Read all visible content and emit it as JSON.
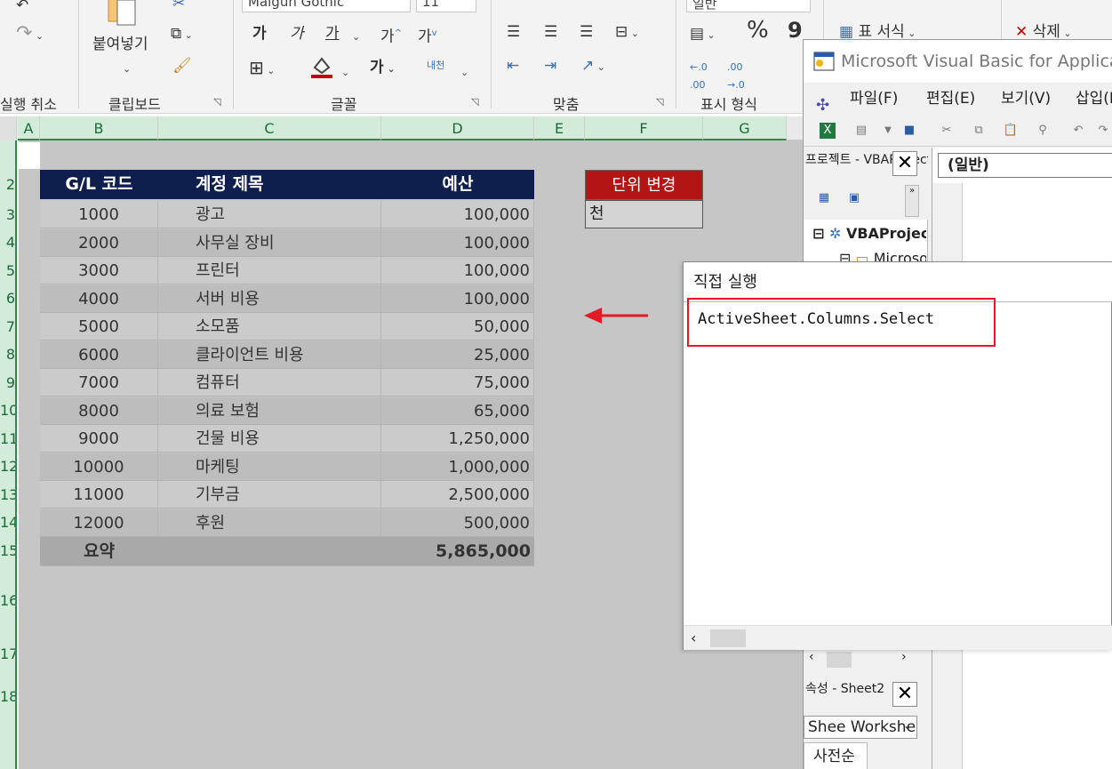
{
  "ribbon": {
    "undo_group_label": "실행 취소",
    "clipboard": {
      "paste_label": "붙여넣기",
      "group_label": "클립보드"
    },
    "font": {
      "font_name": "Malgun Gothic",
      "font_size": "11",
      "bold": "가",
      "italic": "가",
      "underline": "가",
      "grow": "가",
      "shrink": "가",
      "bold2": "가",
      "phonetic": "내천",
      "group_label": "글꼴"
    },
    "alignment": {
      "group_label": "맞춤"
    },
    "number": {
      "format_value": "일반",
      "percent": "%",
      "comma": "9",
      "group_label": "표시 형식"
    },
    "styles": {
      "format_table": "표 서식"
    },
    "cells": {
      "delete": "삭제"
    }
  },
  "columns": [
    "A",
    "B",
    "C",
    "D",
    "E",
    "F",
    "G"
  ],
  "rows": [
    "2",
    "3",
    "4",
    "5",
    "6",
    "7",
    "8",
    "9",
    "10",
    "11",
    "12",
    "13",
    "14",
    "15",
    "16",
    "17",
    "18"
  ],
  "table": {
    "headers": [
      "G/L 코드",
      "계정 제목",
      "예산"
    ],
    "rows": [
      [
        "1000",
        "광고",
        "100,000"
      ],
      [
        "2000",
        "사무실 장비",
        "100,000"
      ],
      [
        "3000",
        "프린터",
        "100,000"
      ],
      [
        "4000",
        "서버 비용",
        "100,000"
      ],
      [
        "5000",
        "소모품",
        "50,000"
      ],
      [
        "6000",
        "클라이언트 비용",
        "25,000"
      ],
      [
        "7000",
        "컴퓨터",
        "75,000"
      ],
      [
        "8000",
        "의료 보험",
        "65,000"
      ],
      [
        "9000",
        "건물 비용",
        "1,250,000"
      ],
      [
        "10000",
        "마케팅",
        "1,000,000"
      ],
      [
        "11000",
        "기부금",
        "2,500,000"
      ],
      [
        "12000",
        "후원",
        "500,000"
      ]
    ],
    "summary_label": "요약",
    "summary_value": "5,865,000"
  },
  "unit_box": {
    "header": "단위 변경",
    "value": "천"
  },
  "vba": {
    "title": "Microsoft Visual Basic for Applications",
    "menu": [
      "파일(F)",
      "편집(E)",
      "보기(V)",
      "삽입(I)"
    ],
    "project_pane_title": "프로젝트 - VBAProject",
    "project_root": "VBAProject",
    "project_child": "Microsoft Excel 개체",
    "general_dropdown": "(일반)",
    "props_title": "속성 - Sheet2",
    "props_object": "Shee Worksheet",
    "props_tab": "사전순"
  },
  "immediate": {
    "title": "직접 실행",
    "code": "ActiveSheet.Columns.Select"
  }
}
